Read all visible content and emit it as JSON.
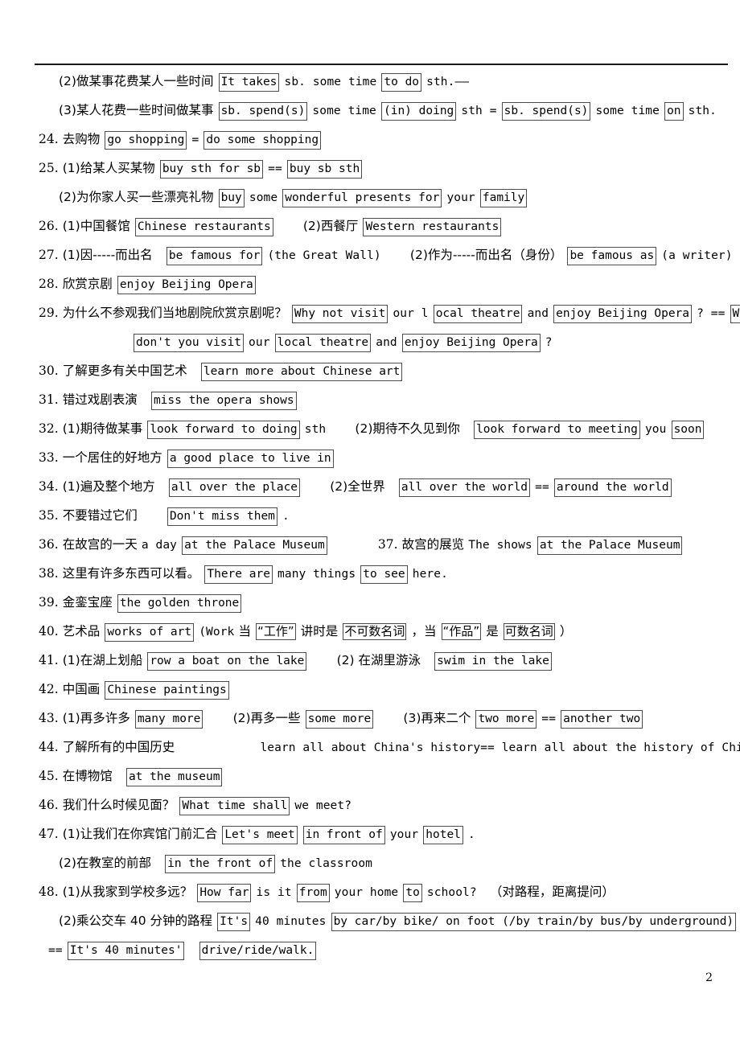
{
  "document": {
    "page_number": "2",
    "header_rule": true
  },
  "lines": [
    {
      "id": "line-23-2",
      "indent": "ind-1",
      "runs": [
        {
          "type": "cn",
          "text": "(2)做某事花费某人一些时间"
        },
        {
          "type": "box",
          "text": "It takes"
        },
        {
          "type": "en",
          "text": "sb. some time"
        },
        {
          "type": "box",
          "text": "to do"
        },
        {
          "type": "en",
          "text": "sth.——"
        }
      ]
    },
    {
      "id": "line-23-3",
      "indent": "ind-1",
      "runs": [
        {
          "type": "cn",
          "text": "(3)某人花费一些时间做某事"
        },
        {
          "type": "box",
          "text": "sb. spend(s)"
        },
        {
          "type": "en",
          "text": "some time"
        },
        {
          "type": "box",
          "text": "(in) doing"
        },
        {
          "type": "en",
          "text": "sth ="
        },
        {
          "type": "box",
          "text": "sb. spend(s)"
        },
        {
          "type": "en",
          "text": "some time"
        },
        {
          "type": "box",
          "text": "on"
        },
        {
          "type": "en",
          "text": "sth."
        }
      ]
    },
    {
      "id": "line-24",
      "indent": "ind-0",
      "runs": [
        {
          "type": "num",
          "text": "24."
        },
        {
          "type": "cn",
          "text": "去购物"
        },
        {
          "type": "box",
          "text": "go shopping"
        },
        {
          "type": "en",
          "text": "="
        },
        {
          "type": "box",
          "text": "do some shopping"
        }
      ]
    },
    {
      "id": "line-25-1",
      "indent": "ind-0",
      "runs": [
        {
          "type": "num",
          "text": "25."
        },
        {
          "type": "cn",
          "text": "(1)给某人买某物"
        },
        {
          "type": "box",
          "text": "buy sth for sb"
        },
        {
          "type": "en",
          "text": "=="
        },
        {
          "type": "box",
          "text": "buy sb sth"
        }
      ]
    },
    {
      "id": "line-25-2",
      "indent": "ind-1",
      "runs": [
        {
          "type": "cn",
          "text": "(2)为你家人买一些漂亮礼物"
        },
        {
          "type": "box",
          "text": "buy"
        },
        {
          "type": "en",
          "text": "some"
        },
        {
          "type": "box",
          "text": "wonderful presents for"
        },
        {
          "type": "en",
          "text": "your"
        },
        {
          "type": "box",
          "text": "family"
        }
      ]
    },
    {
      "id": "line-26",
      "indent": "ind-0",
      "runs": [
        {
          "type": "num",
          "text": "26."
        },
        {
          "type": "cn",
          "text": "(1)中国餐馆"
        },
        {
          "type": "box",
          "text": "Chinese restaurants"
        },
        {
          "type": "sp-lg"
        },
        {
          "type": "cn",
          "text": "(2)西餐厅"
        },
        {
          "type": "box",
          "text": "Western restaurants"
        }
      ]
    },
    {
      "id": "line-27",
      "indent": "ind-0",
      "runs": [
        {
          "type": "num",
          "text": "27."
        },
        {
          "type": "cn",
          "text": "(1)因-----而出名"
        },
        {
          "type": "sp"
        },
        {
          "type": "box",
          "text": "be famous for"
        },
        {
          "type": "en",
          "text": "(the Great Wall)"
        },
        {
          "type": "sp-lg"
        },
        {
          "type": "cn",
          "text": "(2)作为-----而出名（身份）"
        },
        {
          "type": "box",
          "text": "be famous as"
        },
        {
          "type": "en",
          "text": "(a writer)"
        }
      ]
    },
    {
      "id": "line-28",
      "indent": "ind-0",
      "runs": [
        {
          "type": "num",
          "text": "28."
        },
        {
          "type": "cn",
          "text": "欣赏京剧"
        },
        {
          "type": "box",
          "text": "enjoy Beijing Opera"
        }
      ]
    },
    {
      "id": "line-29-a",
      "indent": "ind-0",
      "runs": [
        {
          "type": "num",
          "text": "29."
        },
        {
          "type": "cn",
          "text": "为什么不参观我们当地剧院欣赏京剧呢？"
        },
        {
          "type": "box",
          "text": "Why not visit"
        },
        {
          "type": "en",
          "text": "our l"
        },
        {
          "type": "box",
          "text": "ocal theatre"
        },
        {
          "type": "en",
          "text": "and"
        },
        {
          "type": "box",
          "text": "enjoy Beijing Opera"
        },
        {
          "type": "en",
          "text": "? =="
        },
        {
          "type": "box",
          "text": "Why"
        }
      ]
    },
    {
      "id": "line-29-b",
      "indent": "ind-2",
      "runs": [
        {
          "type": "box",
          "text": "don't you visit"
        },
        {
          "type": "en",
          "text": "our"
        },
        {
          "type": "box",
          "text": "local theatre"
        },
        {
          "type": "en",
          "text": "and"
        },
        {
          "type": "box",
          "text": "enjoy Beijing Opera"
        },
        {
          "type": "en",
          "text": "?"
        }
      ]
    },
    {
      "id": "line-30",
      "indent": "ind-0",
      "runs": [
        {
          "type": "num",
          "text": "30."
        },
        {
          "type": "cn",
          "text": "了解更多有关中国艺术"
        },
        {
          "type": "sp"
        },
        {
          "type": "box",
          "text": "learn more about Chinese art"
        }
      ]
    },
    {
      "id": "line-31",
      "indent": "ind-0",
      "runs": [
        {
          "type": "num",
          "text": "31."
        },
        {
          "type": "cn",
          "text": "错过戏剧表演"
        },
        {
          "type": "sp"
        },
        {
          "type": "box",
          "text": "miss the opera shows"
        }
      ]
    },
    {
      "id": "line-32",
      "indent": "ind-0",
      "runs": [
        {
          "type": "num",
          "text": "32."
        },
        {
          "type": "cn",
          "text": "(1)期待做某事"
        },
        {
          "type": "box",
          "text": "look forward to doing"
        },
        {
          "type": "en",
          "text": "sth"
        },
        {
          "type": "sp-lg"
        },
        {
          "type": "cn",
          "text": "(2)期待不久见到你"
        },
        {
          "type": "sp"
        },
        {
          "type": "box",
          "text": "look forward to meeting"
        },
        {
          "type": "en",
          "text": "you"
        },
        {
          "type": "box",
          "text": "soon"
        }
      ]
    },
    {
      "id": "line-33",
      "indent": "ind-0",
      "runs": [
        {
          "type": "num",
          "text": "33."
        },
        {
          "type": "cn",
          "text": "一个居住的好地方"
        },
        {
          "type": "box",
          "text": "a good place to live in"
        }
      ]
    },
    {
      "id": "line-34",
      "indent": "ind-0",
      "runs": [
        {
          "type": "num",
          "text": "34."
        },
        {
          "type": "cn",
          "text": "(1)遍及整个地方"
        },
        {
          "type": "sp"
        },
        {
          "type": "box",
          "text": " all over the place "
        },
        {
          "type": "sp-lg"
        },
        {
          "type": "cn",
          "text": "(2)全世界"
        },
        {
          "type": "sp"
        },
        {
          "type": "box",
          "text": "all over the world"
        },
        {
          "type": "en",
          "text": "=="
        },
        {
          "type": "box",
          "text": "around the world"
        }
      ]
    },
    {
      "id": "line-35",
      "indent": "ind-0",
      "runs": [
        {
          "type": "num",
          "text": "35."
        },
        {
          "type": "cn",
          "text": "不要错过它们"
        },
        {
          "type": "sp-lg"
        },
        {
          "type": "box",
          "text": "Don't miss them"
        },
        {
          "type": "en",
          "text": "."
        }
      ]
    },
    {
      "id": "line-36-37",
      "indent": "ind-0",
      "runs": [
        {
          "type": "num",
          "text": "36."
        },
        {
          "type": "cn",
          "text": "在故宫的一天"
        },
        {
          "type": "en",
          "text": "a day"
        },
        {
          "type": "box",
          "text": "at the Palace Museum"
        },
        {
          "type": "sp-xl"
        },
        {
          "type": "num",
          "text": "37."
        },
        {
          "type": "cn",
          "text": "故宫的展览"
        },
        {
          "type": "en",
          "text": "The shows"
        },
        {
          "type": "box",
          "text": "at the Palace Museum"
        }
      ]
    },
    {
      "id": "line-38",
      "indent": "ind-0",
      "runs": [
        {
          "type": "num",
          "text": "38."
        },
        {
          "type": "cn",
          "text": "这里有许多东西可以看。"
        },
        {
          "type": "box",
          "text": "There are"
        },
        {
          "type": "en",
          "text": "many things"
        },
        {
          "type": "box",
          "text": "to see"
        },
        {
          "type": "en",
          "text": "here."
        }
      ]
    },
    {
      "id": "line-39",
      "indent": "ind-0",
      "runs": [
        {
          "type": "num",
          "text": "39."
        },
        {
          "type": "cn",
          "text": "金銮宝座"
        },
        {
          "type": "box",
          "text": "the golden throne"
        }
      ]
    },
    {
      "id": "line-40",
      "indent": "ind-0",
      "runs": [
        {
          "type": "num",
          "text": "40."
        },
        {
          "type": "cn",
          "text": "艺术品"
        },
        {
          "type": "box",
          "text": "works of art"
        },
        {
          "type": "en",
          "text": "(Work"
        },
        {
          "type": "cn",
          "text": "当"
        },
        {
          "type": "cnbox",
          "text": "“工作”"
        },
        {
          "type": "cn",
          "text": "讲时是"
        },
        {
          "type": "cnbox",
          "text": "不可数名词"
        },
        {
          "type": "cn",
          "text": "，当"
        },
        {
          "type": "cnbox",
          "text": "“作品”"
        },
        {
          "type": "cn",
          "text": "是"
        },
        {
          "type": "cnbox",
          "text": "可数名词"
        },
        {
          "type": "cn",
          "text": "）"
        }
      ]
    },
    {
      "id": "line-41",
      "indent": "ind-0",
      "runs": [
        {
          "type": "num",
          "text": "41."
        },
        {
          "type": "cn",
          "text": "(1)在湖上划船"
        },
        {
          "type": "box",
          "text": "row a boat on the lake"
        },
        {
          "type": "sp-lg"
        },
        {
          "type": "cn",
          "text": "(2) 在湖里游泳"
        },
        {
          "type": "sp"
        },
        {
          "type": "box",
          "text": "swim in the lake"
        }
      ]
    },
    {
      "id": "line-42",
      "indent": "ind-0",
      "runs": [
        {
          "type": "num",
          "text": "42."
        },
        {
          "type": "cn",
          "text": "中国画"
        },
        {
          "type": "box",
          "text": "Chinese paintings "
        }
      ]
    },
    {
      "id": "line-43",
      "indent": "ind-0",
      "runs": [
        {
          "type": "num",
          "text": "43."
        },
        {
          "type": "cn",
          "text": "(1)再多许多"
        },
        {
          "type": "box",
          "text": "many more "
        },
        {
          "type": "sp-lg"
        },
        {
          "type": "cn",
          "text": "(2)再多一些"
        },
        {
          "type": "box",
          "text": "some more "
        },
        {
          "type": "sp-lg"
        },
        {
          "type": "cn",
          "text": "(3)再来二个"
        },
        {
          "type": "box",
          "text": "two more"
        },
        {
          "type": "en",
          "text": "=="
        },
        {
          "type": "box",
          "text": "another two"
        }
      ]
    },
    {
      "id": "line-44",
      "indent": "ind-0",
      "runs": [
        {
          "type": "num",
          "text": "44."
        },
        {
          "type": "cn",
          "text": "了解所有的中国历史"
        },
        {
          "type": "sp-xxl"
        },
        {
          "type": "en",
          "text": "learn all about China's history== learn all about the history of China"
        }
      ]
    },
    {
      "id": "line-45",
      "indent": "ind-0",
      "runs": [
        {
          "type": "num",
          "text": "45."
        },
        {
          "type": "cn",
          "text": "在博物馆"
        },
        {
          "type": "sp"
        },
        {
          "type": "box",
          "text": "at the museum"
        }
      ]
    },
    {
      "id": "line-46",
      "indent": "ind-0",
      "runs": [
        {
          "type": "num",
          "text": "46."
        },
        {
          "type": "cn",
          "text": "我们什么时候见面？"
        },
        {
          "type": "box",
          "text": "What time shall"
        },
        {
          "type": "en",
          "text": "we meet?"
        }
      ]
    },
    {
      "id": "line-47-1",
      "indent": "ind-0",
      "runs": [
        {
          "type": "num",
          "text": "47."
        },
        {
          "type": "cn",
          "text": "(1)让我们在你宾馆门前汇合"
        },
        {
          "type": "box",
          "text": "Let's meet"
        },
        {
          "type": "box",
          "text": "in front of"
        },
        {
          "type": "en",
          "text": "your"
        },
        {
          "type": "box",
          "text": "hotel "
        },
        {
          "type": "en",
          "text": "."
        }
      ]
    },
    {
      "id": "line-47-2",
      "indent": "ind-1",
      "runs": [
        {
          "type": "cn",
          "text": "(2)在教室的前部"
        },
        {
          "type": "sp"
        },
        {
          "type": "box",
          "text": "in the front of"
        },
        {
          "type": "en",
          "text": "the classroom"
        }
      ]
    },
    {
      "id": "line-48-1",
      "indent": "ind-0",
      "runs": [
        {
          "type": "num",
          "text": "48."
        },
        {
          "type": "cn",
          "text": "(1)从我家到学校多远？"
        },
        {
          "type": "box",
          "text": "How far"
        },
        {
          "type": "en",
          "text": "is it"
        },
        {
          "type": "box",
          "text": "from"
        },
        {
          "type": "en",
          "text": "your home"
        },
        {
          "type": "box",
          "text": "to"
        },
        {
          "type": "en",
          "text": "school?"
        },
        {
          "type": "sp"
        },
        {
          "type": "cn",
          "text": "（对路程，距离提问）"
        }
      ]
    },
    {
      "id": "line-48-2",
      "indent": "ind-1",
      "runs": [
        {
          "type": "cn",
          "text": "(2)乘公交车 40 分钟的路程"
        },
        {
          "type": "box",
          "text": "It's"
        },
        {
          "type": "en",
          "text": "40 minutes"
        },
        {
          "type": "box",
          "text": "by car/by bike/ on foot (/by train/by bus/by underground)"
        }
      ]
    },
    {
      "id": "line-48-3",
      "indent": "ind-3",
      "runs": [
        {
          "type": "en",
          "text": "=="
        },
        {
          "type": "box",
          "text": "It's 40 minutes'"
        },
        {
          "type": "sp"
        },
        {
          "type": "box",
          "text": "drive/ride/walk."
        }
      ]
    }
  ]
}
